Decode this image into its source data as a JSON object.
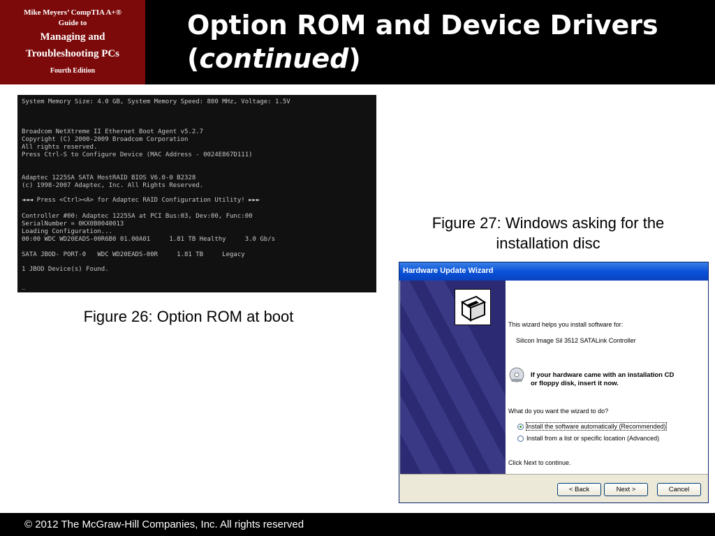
{
  "book": {
    "line1": "Mike Meyers’ CompTIA A+®",
    "line2": "Guide to",
    "line3": "Managing and",
    "line4": "Troubleshooting PCs",
    "line5": "Fourth Edition"
  },
  "slide": {
    "title_line1": "Option ROM and Device Drivers",
    "title_open": "(",
    "title_italic": "continued",
    "title_close": ")"
  },
  "boot_screen": {
    "lines": [
      "System Memory Size: 4.0 GB, System Memory Speed: 800 MHz, Voltage: 1.5V",
      "Broadcom NetXtreme II Ethernet Boot Agent v5.2.7",
      "Copyright (C) 2000-2009 Broadcom Corporation",
      "All rights reserved.",
      "Press Ctrl-S to Configure Device (MAC Address - 0024E867D111)",
      "Adaptec 1225SA SATA HostRAID BIOS V6.0-0 B2328",
      "(c) 1998-2007 Adaptec, Inc. All Rights Reserved.",
      "◄◄◄ Press <Ctrl><A> for Adaptec RAID Configuration Utility! ►►►",
      "Controller #00: Adaptec 1225SA at PCI Bus:03, Dev:00, Func:00",
      "SerialNumber = 0KX0B0040013",
      "Loading Configuration...",
      "00:00 WDC WD20EADS-00R6B0 01.00A01     1.81 TB Healthy     3.0 Gb/s",
      "SATA JBOD- PORT-0   WDC WD20EADS-00R     1.81 TB     Legacy",
      "1 JBOD Device(s) Found.",
      "_"
    ]
  },
  "captions": {
    "fig26": "Figure 26: Option ROM at boot",
    "fig27_line1": "Figure 27: Windows asking for the",
    "fig27_line2": "installation disc"
  },
  "wizard": {
    "title": "Hardware Update Wizard",
    "intro": "This wizard helps you install software for:",
    "device": "Silicon Image Sil 3512 SATALink Controller",
    "cd_line1": "If your hardware came with an installation CD",
    "cd_line2": "or floppy disk, insert it now.",
    "question": "What do you want the wizard to do?",
    "option1": "Install the software automatically (Recommended)",
    "option2": "Install from a list or specific location (Advanced)",
    "continue": "Click Next to continue.",
    "back": "< Back",
    "next": "Next >",
    "cancel": "Cancel"
  },
  "footer": {
    "copyright": "© 2012 The McGraw-Hill Companies, Inc. All rights reserved"
  }
}
